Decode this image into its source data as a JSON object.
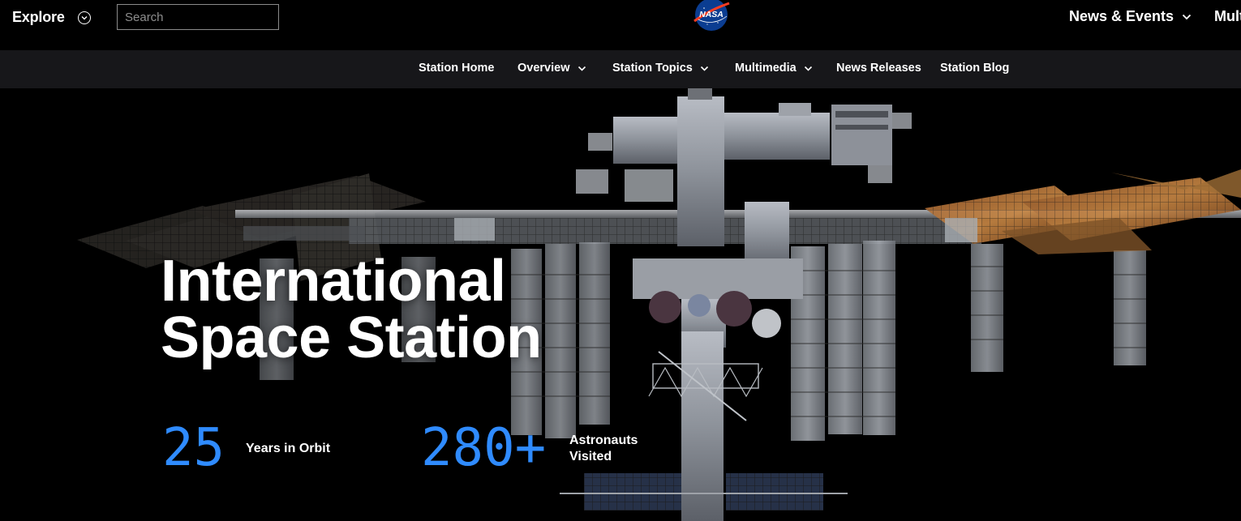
{
  "header": {
    "explore_label": "Explore",
    "search_placeholder": "Search",
    "logo_text": "NASA",
    "news_events_label": "News & Events",
    "multimedia_cut_label": "Mult"
  },
  "subnav": {
    "items": [
      {
        "label": "Station Home",
        "has_dropdown": false
      },
      {
        "label": "Overview",
        "has_dropdown": true
      },
      {
        "label": "Station Topics",
        "has_dropdown": true
      },
      {
        "label": "Multimedia",
        "has_dropdown": true
      },
      {
        "label": "News Releases",
        "has_dropdown": false
      },
      {
        "label": "Station Blog",
        "has_dropdown": false
      }
    ]
  },
  "hero": {
    "title_line1": "International",
    "title_line2": "Space Station",
    "stats": [
      {
        "number": "25",
        "label_line1": "Years in Orbit",
        "label_line2": ""
      },
      {
        "number": "280+",
        "label_line1": "Astronauts",
        "label_line2": "Visited"
      }
    ]
  },
  "colors": {
    "background": "#000000",
    "subnav_background": "#17171a",
    "stat_accent": "#2f8bff",
    "text": "#ffffff"
  },
  "icons": [
    "chevron-circle-icon",
    "nasa-logo",
    "chevron-down-icon"
  ]
}
